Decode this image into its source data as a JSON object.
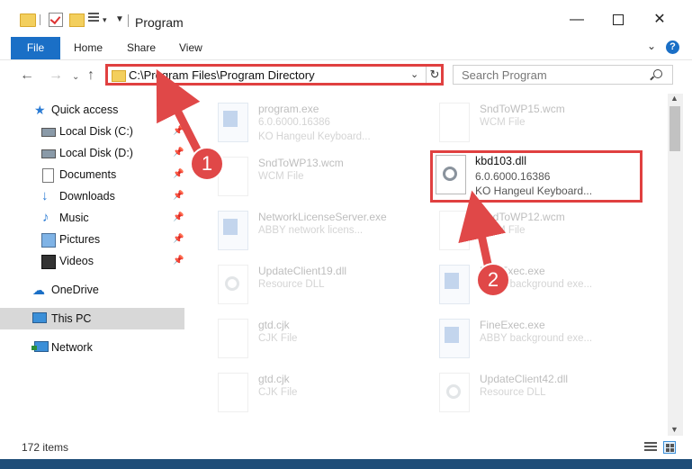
{
  "window": {
    "title": "Program"
  },
  "ribbon": {
    "file": "File",
    "home": "Home",
    "share": "Share",
    "view": "View"
  },
  "address": {
    "path": "C:\\Program Files\\Program Directory"
  },
  "search": {
    "placeholder": "Search Program"
  },
  "sidebar": {
    "items": [
      {
        "label": "Quick access"
      },
      {
        "label": "Local Disk (C:)"
      },
      {
        "label": "Local Disk (D:)"
      },
      {
        "label": "Documents"
      },
      {
        "label": "Downloads"
      },
      {
        "label": "Music"
      },
      {
        "label": "Pictures"
      },
      {
        "label": "Videos"
      },
      {
        "label": "OneDrive"
      },
      {
        "label": "This PC"
      },
      {
        "label": "Network"
      }
    ]
  },
  "files": [
    {
      "name": "program.exe",
      "line1": "6.0.6000.16386",
      "line2": "KO Hangeul Keyboard..."
    },
    {
      "name": "SndToWP15.wcm",
      "line1": "WCM File",
      "line2": ""
    },
    {
      "name": "SndToWP13.wcm",
      "line1": "WCM File",
      "line2": ""
    },
    {
      "name": "NetworkLicenseServer.exe",
      "line1": "ABBY network licens...",
      "line2": ""
    },
    {
      "name": "SndToWP12.wcm",
      "line1": "WCM File",
      "line2": ""
    },
    {
      "name": "UpdateClient19.dll",
      "line1": "Resource DLL",
      "line2": ""
    },
    {
      "name": "FineExec.exe",
      "line1": "ABBY background exe...",
      "line2": ""
    },
    {
      "name": "gtd.cjk",
      "line1": "CJK File",
      "line2": ""
    },
    {
      "name": "FineExec.exe",
      "line1": "ABBY background exe...",
      "line2": ""
    },
    {
      "name": "gtd.cjk",
      "line1": "CJK File",
      "line2": ""
    },
    {
      "name": "UpdateClient42.dll",
      "line1": "Resource DLL",
      "line2": ""
    }
  ],
  "highlighted_file": {
    "name": "kbd103.dll",
    "version": "6.0.6000.16386",
    "description": "KO Hangeul Keyboard..."
  },
  "status": {
    "items": "172 items"
  },
  "annotations": {
    "step1": "1",
    "step2": "2"
  },
  "colors": {
    "accent": "#1a6fc6",
    "annotation": "#e04040"
  }
}
